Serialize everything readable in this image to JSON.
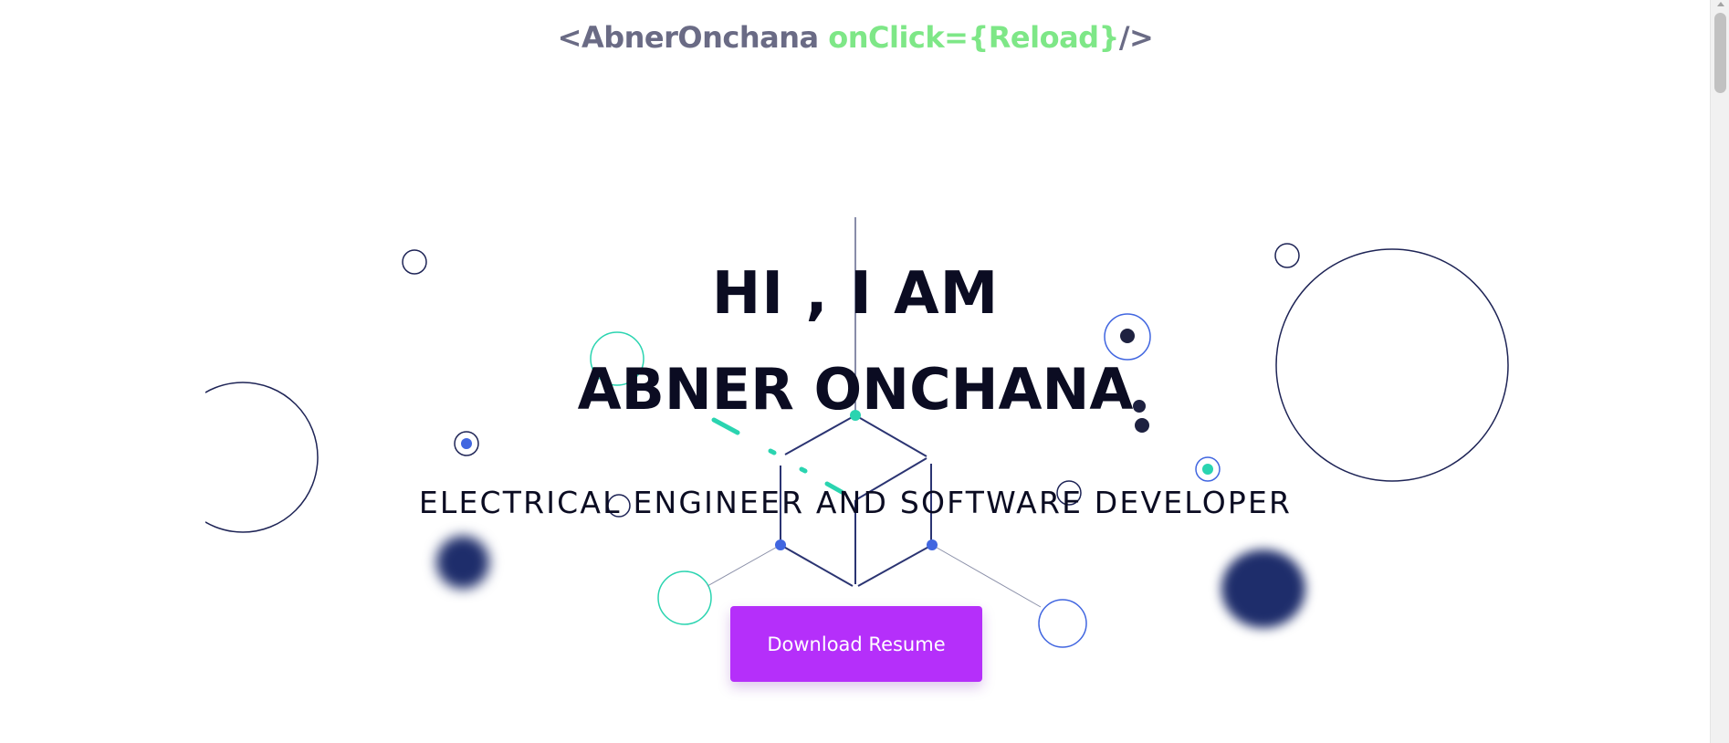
{
  "header": {
    "logo_open": "<",
    "logo_name": "AbnerOnchana",
    "logo_attr": "onClick={Reload}",
    "logo_close": "/>"
  },
  "hero": {
    "greeting": "HI , I AM",
    "name": "ABNER ONCHANA",
    "role": "ELECTRICAL ENGINEER AND SOFTWARE DEVELOPER",
    "download_label": "Download Resume"
  },
  "colors": {
    "heading": "#0b0c22",
    "logo_gray": "#6a6b85",
    "logo_green": "#7ee787",
    "button": "#b52ffa",
    "accent_teal": "#2ad4b0",
    "accent_blue": "#4166e0",
    "navy": "#1e2d6b"
  },
  "icons": {
    "scroll_up": "chevron-up-icon"
  }
}
